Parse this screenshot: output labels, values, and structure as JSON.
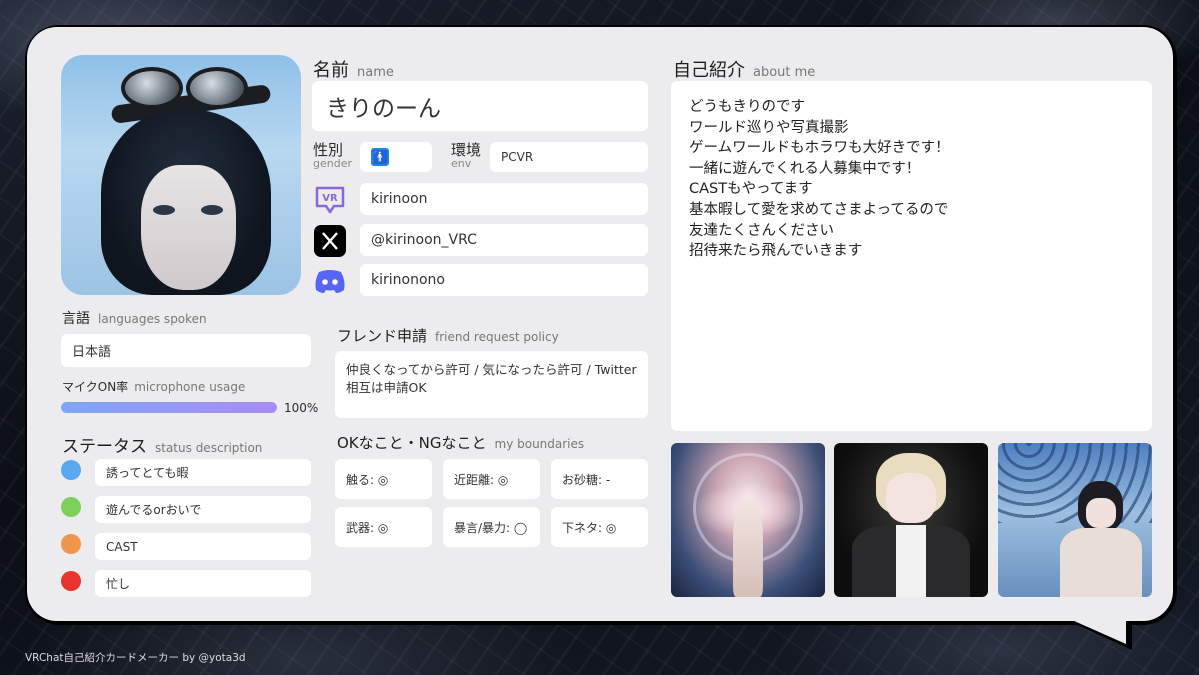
{
  "name": {
    "label_jp": "名前",
    "label_en": "name",
    "value": "きりのーん"
  },
  "gender": {
    "label_jp": "性別",
    "label_en": "gender",
    "value": "🚹"
  },
  "env": {
    "label_jp": "環境",
    "label_en": "env",
    "value": "PCVR"
  },
  "accounts": [
    {
      "icon": "vrchat-icon",
      "value": "kirinoon"
    },
    {
      "icon": "x-twitter-icon",
      "value": "@kirinoon_VRC"
    },
    {
      "icon": "discord-icon",
      "value": "kirinonono"
    }
  ],
  "languages": {
    "label_jp": "言語",
    "label_en": "languages spoken",
    "value": "日本語"
  },
  "mic": {
    "label_jp": "マイクON率",
    "label_en": "microphone usage",
    "value": 100,
    "value_text": "100%"
  },
  "status": {
    "label_jp": "ステータス",
    "label_en": "status description",
    "items": [
      {
        "color": "#5aa9f0",
        "text": "誘ってとても暇"
      },
      {
        "color": "#7ed05a",
        "text": "遊んでるorおいで"
      },
      {
        "color": "#f0954e",
        "text": "CAST"
      },
      {
        "color": "#e8332f",
        "text": "忙し"
      }
    ]
  },
  "friend": {
    "label_jp": "フレンド申請",
    "label_en": "friend request policy",
    "value": "仲良くなってから許可 / 気になったら許可 / Twitter相互は申請OK"
  },
  "boundaries": {
    "label_jp": "OKなこと・NGなこと",
    "label_en": "my boundaries",
    "items": [
      "触る: ◎",
      "近距離: ◎",
      "お砂糖: -",
      "武器: ◎",
      "暴言/暴力: ◯",
      "下ネタ: ◎"
    ]
  },
  "about": {
    "label_jp": "自己紹介",
    "label_en": "about me",
    "text": "どうもきりのです\nワールド巡りや写真撮影\nゲームワールドもホラワも大好きです！\n一緒に遊んでくれる人募集中です！\nCASTもやってます\n基本暇して愛を求めてさまよってるので\n友達たくさんください\n招待来たら飛んでいきます"
  },
  "footer": "VRChat自己紹介カードメーカー by @yota3d"
}
